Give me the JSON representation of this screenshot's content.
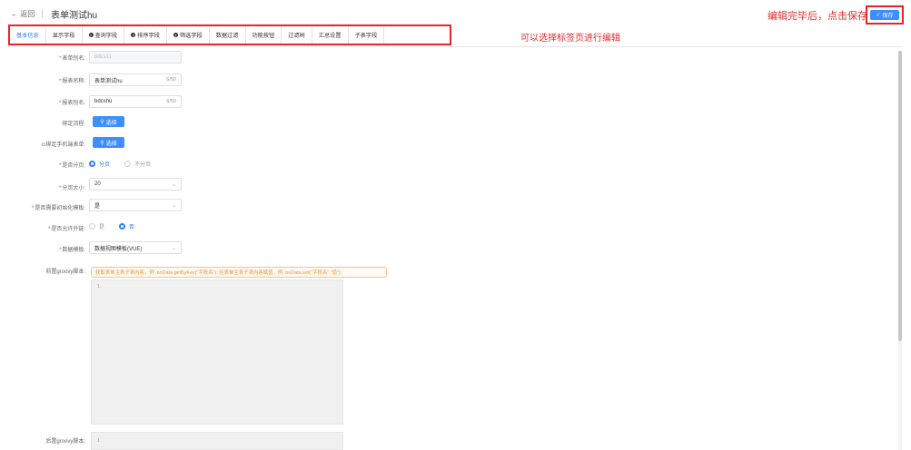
{
  "header": {
    "back_label": "← 返回",
    "title": "表单测试hu",
    "save_note": "编辑完毕后，点击保存",
    "save_label": "保存"
  },
  "tabs": [
    {
      "label": "基本信息",
      "info": false
    },
    {
      "label": "显示字段",
      "info": false
    },
    {
      "label": "查询字段",
      "info": true
    },
    {
      "label": "排序字段",
      "info": true
    },
    {
      "label": "筛选字段",
      "info": true
    },
    {
      "label": "数据过滤",
      "info": false
    },
    {
      "label": "功能按钮",
      "info": false
    },
    {
      "label": "过滤树",
      "info": false
    },
    {
      "label": "汇总设置",
      "info": false
    },
    {
      "label": "子表字段",
      "info": false
    }
  ],
  "tab_hint": "可以选择标签页进行编辑",
  "form": {
    "form_alias_label": "表单别名:",
    "form_alias_value": "bdcs11",
    "report_name_label": "报表名称:",
    "report_name_value": "表单测试hu",
    "report_name_count": "6/50",
    "report_alias_label": "报表别名:",
    "report_alias_value": "bdcshu",
    "report_alias_count": "6/50",
    "bind_process_label": "绑定流程:",
    "select_label": "选择",
    "bind_mobile_label": "⊙绑定手机端表单:",
    "paging_label": "是否分页:",
    "paging_yes": "分页",
    "paging_no": "不分页",
    "page_size_label": "分页大小:",
    "page_size_value": "20",
    "init_template_label": "是否需要初始化模板:",
    "init_template_value": "是",
    "allow_fk_label": "是否允许外链:",
    "allow_fk_yes": "是",
    "allow_fk_no": "否",
    "data_template_label": "数据模板:",
    "data_template_value": "数据视图模板(VUE)",
    "pre_groovy_label": "前置groovy脚本:",
    "pre_groovy_hint": "获取表单主表子表内容，例: boData.getByKey(\"字段名\"); 往表单主表子表内容赋值，例: boData.set(\"字段名\",\"值\");",
    "post_groovy_label": "后置groovy脚本:",
    "line_number": "1"
  },
  "colors": {
    "accent": "#3d8eff",
    "annotation": "#e52e2e",
    "hint": "#e6953a"
  }
}
